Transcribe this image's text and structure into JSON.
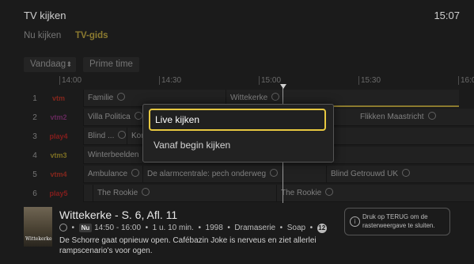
{
  "header": {
    "title": "TV kijken",
    "clock": "15:07"
  },
  "tabs": [
    {
      "label": "Nu kijken",
      "active": false
    },
    {
      "label": "TV-gids",
      "active": true
    }
  ],
  "controls": {
    "day": "Vandaag",
    "prime": "Prime time"
  },
  "timeline": [
    "14:00",
    "14:30",
    "15:00",
    "15:30",
    "16:0"
  ],
  "colors": {
    "accent": "#e7c840",
    "background": "#1b1b1b"
  },
  "channels": [
    {
      "num": "1",
      "logo": "vtm",
      "logo_color": "#d8301e",
      "programs": [
        {
          "title": "Familie",
          "replay": true
        },
        {
          "title": "Wittekerke",
          "replay": true,
          "selected": true
        }
      ]
    },
    {
      "num": "2",
      "logo": "vtm2",
      "logo_color": "#a0348e",
      "programs": [
        {
          "title": "Villa Politica",
          "replay": true
        },
        {
          "title": "Flikken Maastricht",
          "replay": true
        }
      ]
    },
    {
      "num": "3",
      "logo": "play4",
      "logo_color": "#d8201e",
      "programs": [
        {
          "title": "Blind ...",
          "replay": true
        },
        {
          "title": "Kor",
          "replay": false
        }
      ]
    },
    {
      "num": "4",
      "logo": "vtm3",
      "logo_color": "#c8b02a",
      "programs": [
        {
          "title": "Winterbeelden",
          "replay": true
        }
      ]
    },
    {
      "num": "5",
      "logo": "vtm4",
      "logo_color": "#d8301e",
      "programs": [
        {
          "title": "Ambulance",
          "replay": true
        },
        {
          "title": "De alarmcentrale: pech onderweg",
          "replay": true
        },
        {
          "title": "Blind Getrouwd UK",
          "replay": true
        }
      ]
    },
    {
      "num": "6",
      "logo": "play5",
      "logo_color": "#d8201e",
      "programs": [
        {
          "title": "The Rookie",
          "replay": true
        },
        {
          "title": "The Rookie",
          "replay": true
        }
      ]
    }
  ],
  "modal": {
    "options": [
      "Live kijken",
      "Vanaf begin kijken"
    ]
  },
  "detail": {
    "poster_text": "Wittekerke",
    "title": "Wittekerke - S. 6, Afl. 11",
    "badge": "Nu",
    "time": "14:50 - 16:00",
    "duration": "1 u. 10 min.",
    "year": "1998",
    "genre": "Dramaserie",
    "subgenre": "Soap",
    "age": "12",
    "description": "De Schorre gaat opnieuw open. Cafébazin Joke is nerveus en ziet allerlei rampscenario's voor ogen."
  },
  "hint": {
    "icon": "info-icon",
    "text": "Druk op TERUG om de rasterweergave te sluiten."
  }
}
